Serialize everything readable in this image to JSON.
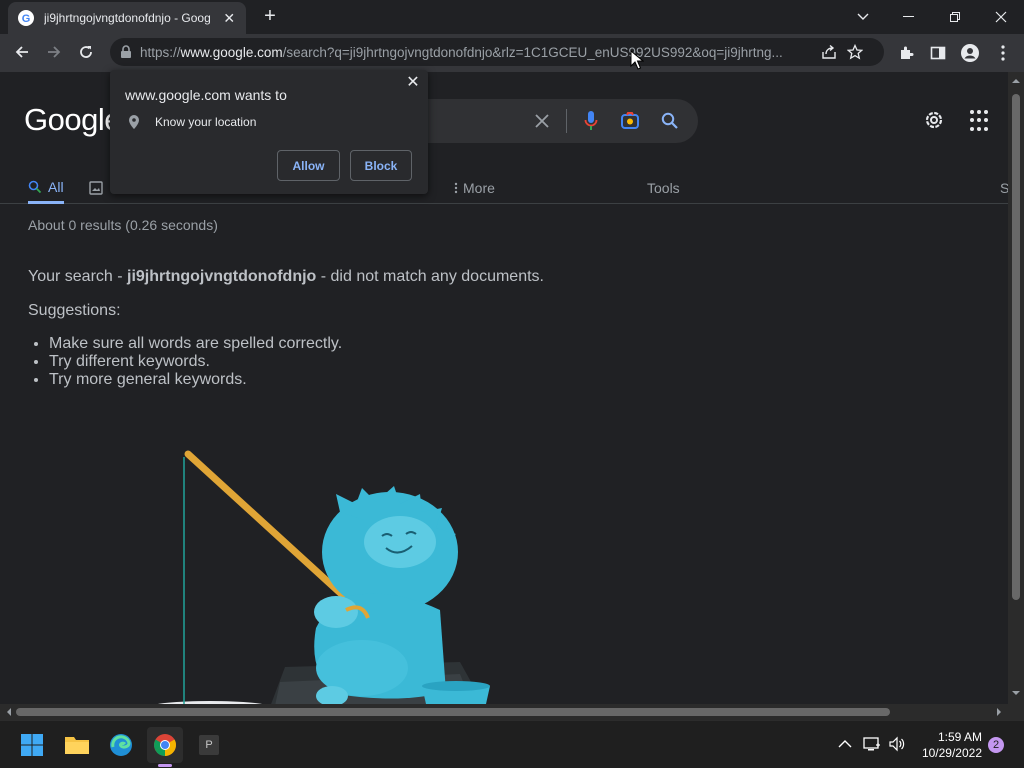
{
  "browser": {
    "tab_title": "ji9jhrtngojvngtdonofdnjo - Goog",
    "tab_close": "✕",
    "new_tab": "+",
    "url_prefix": "https://",
    "url_domain": "www.google.com",
    "url_rest": "/search?q=ji9jhrtngojvngtdonofdnjo&rlz=1C1GCEU_enUS992US992&oq=ji9jhrtng..."
  },
  "google": {
    "logo": "Google",
    "tabs": {
      "all": "All",
      "more": "More",
      "tools": "Tools",
      "cut_off": "S"
    },
    "stats": "About 0 results (0.26 seconds)",
    "no_match_prefix": "Your search - ",
    "query": "ji9jhrtngojvngtdonofdnjo",
    "no_match_suffix": " - did not match any documents.",
    "suggestions_title": "Suggestions:",
    "suggestions": [
      "Make sure all words are spelled correctly.",
      "Try different keywords.",
      "Try more general keywords."
    ]
  },
  "permission": {
    "title": "www.google.com wants to",
    "request": "Know your location",
    "allow": "Allow",
    "block": "Block",
    "close": "✕"
  },
  "taskbar": {
    "time": "1:59 AM",
    "date": "10/29/2022",
    "notifications": "2",
    "pinned_app_letter": "P"
  },
  "colors": {
    "accent": "#8ab4f8",
    "background": "#202124",
    "mascot": "#3bb9d6"
  }
}
